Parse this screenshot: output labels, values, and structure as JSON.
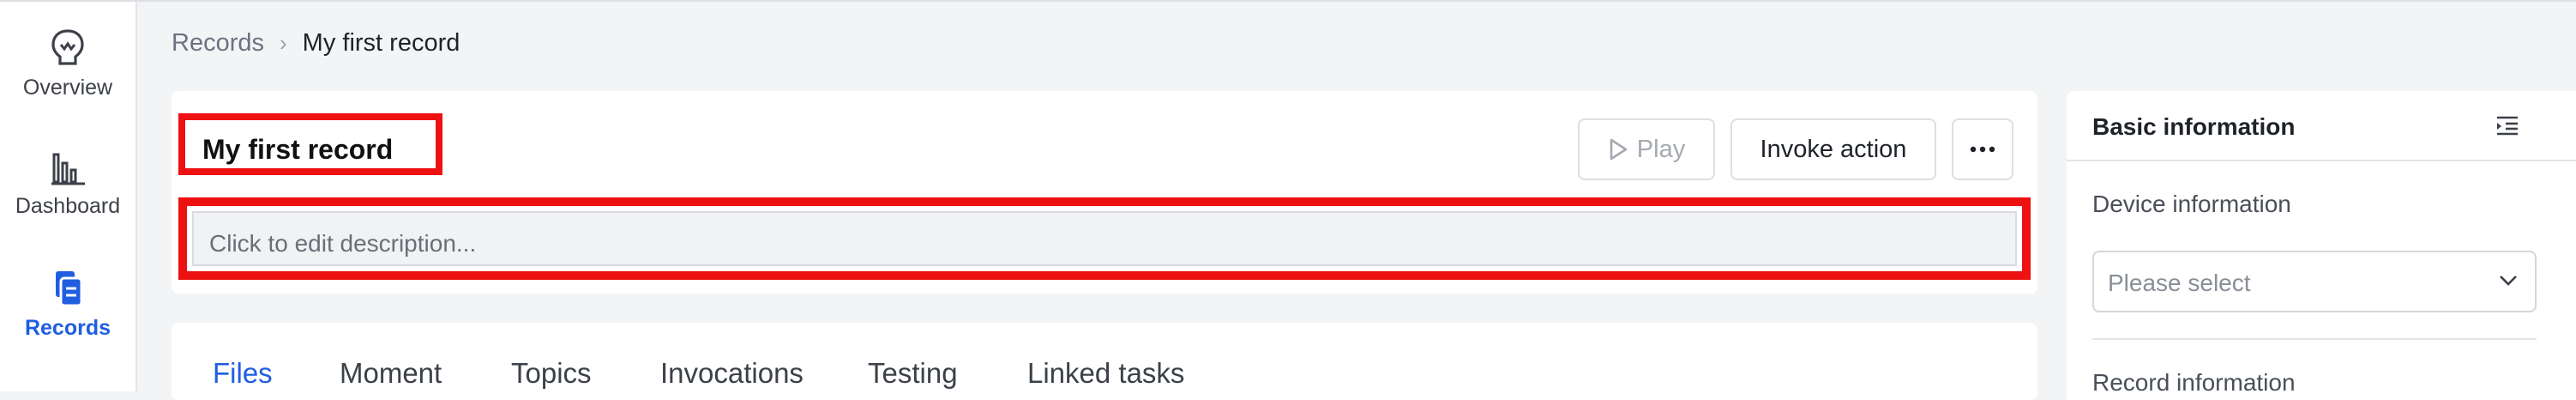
{
  "nav": {
    "items": [
      {
        "label": "Overview",
        "icon": "brain-icon",
        "active": false
      },
      {
        "label": "Dashboard",
        "icon": "bar-chart-icon",
        "active": false
      },
      {
        "label": "Records",
        "icon": "records-icon",
        "active": true
      }
    ]
  },
  "breadcrumb": {
    "items": [
      "Records",
      "My first record"
    ]
  },
  "record": {
    "title": "My first record",
    "description_placeholder": "Click to edit description..."
  },
  "actions": {
    "play_label": "Play",
    "invoke_label": "Invoke action",
    "more_icon": "ellipsis-icon"
  },
  "tabs": [
    {
      "label": "Files",
      "active": true
    },
    {
      "label": "Moment",
      "active": false
    },
    {
      "label": "Topics",
      "active": false
    },
    {
      "label": "Invocations",
      "active": false
    },
    {
      "label": "Testing",
      "active": false
    },
    {
      "label": "Linked tasks",
      "active": false
    }
  ],
  "panel": {
    "title": "Basic information",
    "device_section": "Device information",
    "device_select_placeholder": "Please select",
    "record_section": "Record information"
  },
  "colors": {
    "accent": "#1f5ee0",
    "highlight": "#ee1111",
    "background": "#f3f4f6"
  }
}
